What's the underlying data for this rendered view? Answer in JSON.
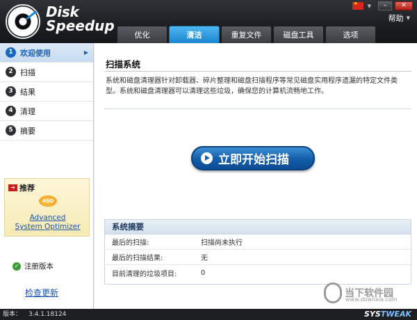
{
  "app": {
    "brand_line1": "Disk",
    "brand_line2": "Speedup",
    "help_label": "帮助",
    "win_min": "–",
    "win_close": "✕"
  },
  "tabs": [
    {
      "label": "优化",
      "active": false
    },
    {
      "label": "清洁",
      "active": true
    },
    {
      "label": "重复文件",
      "active": false
    },
    {
      "label": "磁盘工具",
      "active": false
    },
    {
      "label": "选项",
      "active": false
    }
  ],
  "sidebar": {
    "items": [
      {
        "num": "1",
        "label": "欢迎使用",
        "active": true
      },
      {
        "num": "2",
        "label": "扫描",
        "active": false
      },
      {
        "num": "3",
        "label": "结果",
        "active": false
      },
      {
        "num": "4",
        "label": "清理",
        "active": false
      },
      {
        "num": "5",
        "label": "摘要",
        "active": false
      }
    ],
    "promo": {
      "title": "推荐",
      "icon_text": "ASO",
      "link_line1": "Advanced",
      "link_line2": "System Optimizer"
    },
    "registered_label": "注册版本",
    "check_update_label": "检查更新"
  },
  "main": {
    "title": "扫描系统",
    "description": "系统和磁盘清理器针对卸载器、碎片整理和磁盘扫描程序等常见磁盘实用程序遗漏的特定文件类型。系统和磁盘清理器可以清理这些垃圾，确保您的计算机流畅地工作。",
    "scan_button_label": "立即开始扫描",
    "summary": {
      "title": "系统摘要",
      "rows": [
        {
          "key": "最后的扫描:",
          "value": "扫描尚未执行"
        },
        {
          "key": "最后的扫描结果:",
          "value": "无"
        },
        {
          "key": "目前清理的垃圾项目:",
          "value": "0"
        }
      ]
    }
  },
  "statusbar": {
    "version_label": "版本：",
    "version_value": "3.4.1.18124",
    "vendor_a": "SYS",
    "vendor_b": "TWEAK"
  },
  "watermark": {
    "text": "当下软件园",
    "url": "www.downxia.com"
  },
  "colors": {
    "accent": "#1a84cf",
    "header_bg": "#1c1e22",
    "active_nav": "#1766c4"
  }
}
